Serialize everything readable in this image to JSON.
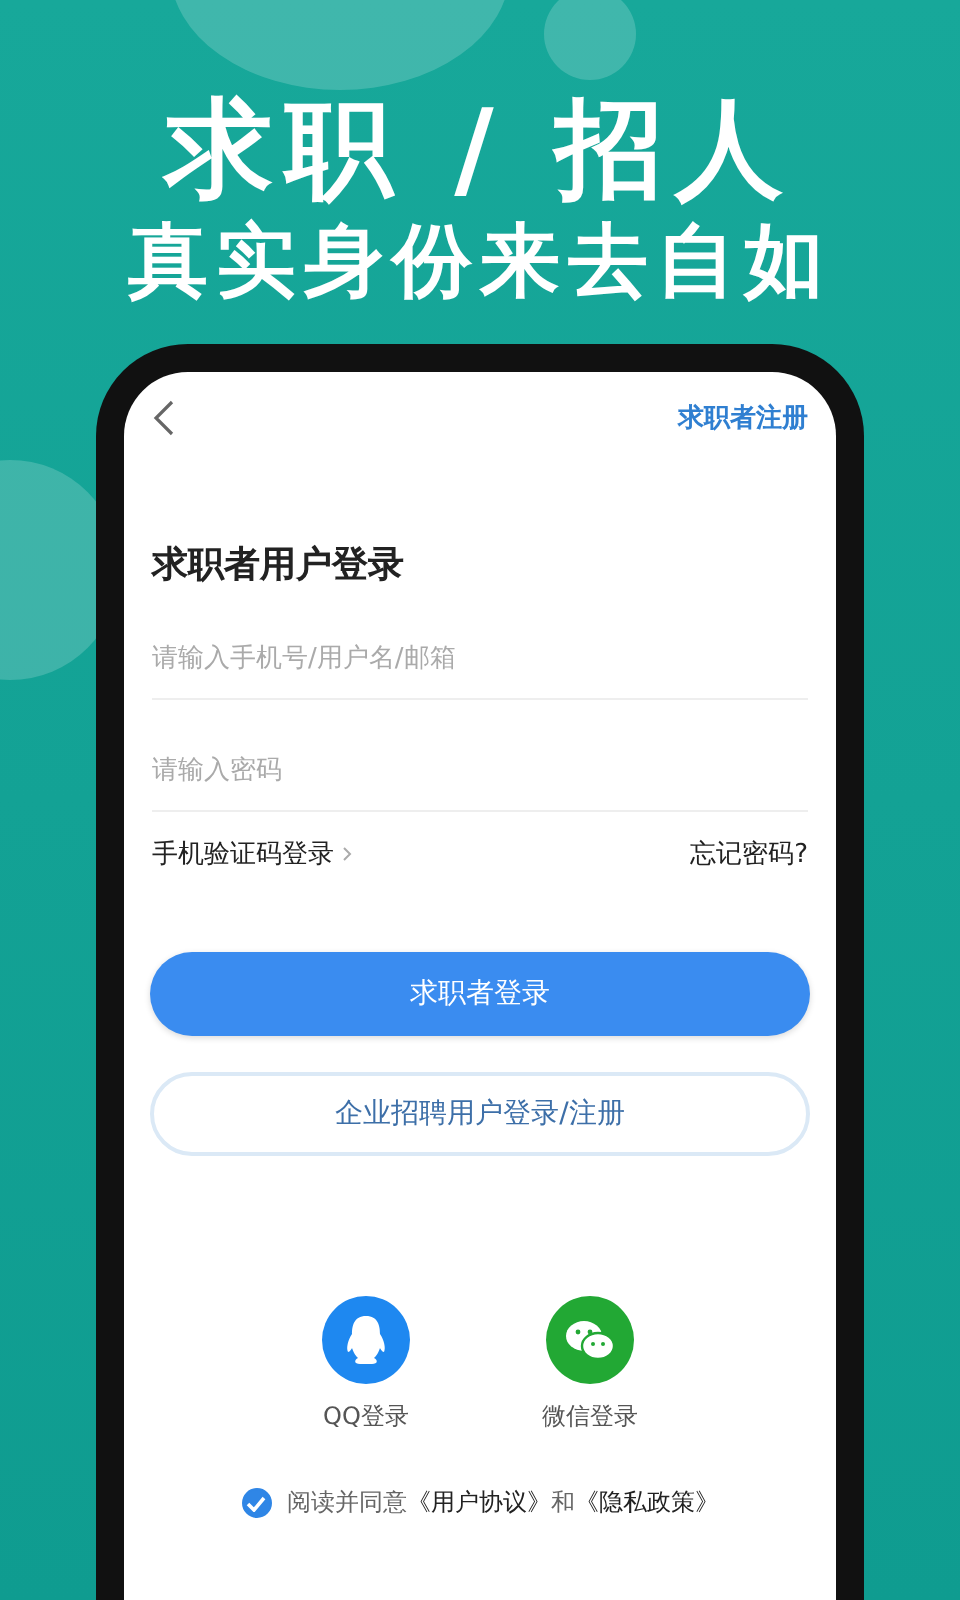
{
  "headline": "求职 / 招人",
  "subtitle": "真实身份来去自如",
  "top_bar": {
    "register_link": "求职者注册"
  },
  "title": "求职者用户登录",
  "fields": [
    {
      "placeholder": "请输入手机号/用户名/邮箱"
    },
    {
      "placeholder": "请输入密码"
    }
  ],
  "sms_login_link": "手机验证码登录",
  "forgot_password_link": "忘记密码?",
  "buttons": [
    {
      "label": "求职者登录",
      "kind": "primary"
    },
    {
      "label": "企业招聘用户登录/注册",
      "kind": "outline"
    }
  ],
  "social_logins": [
    {
      "label": "QQ登录",
      "kind": "qq",
      "color": "#1e88f0"
    },
    {
      "label": "微信登录",
      "kind": "wechat",
      "color": "#22a834"
    }
  ],
  "agreement": {
    "checked": true,
    "prefix": "阅读并同意",
    "link_1": "《用户协议》",
    "middle": "和",
    "link_2": "《隐私政策》"
  }
}
